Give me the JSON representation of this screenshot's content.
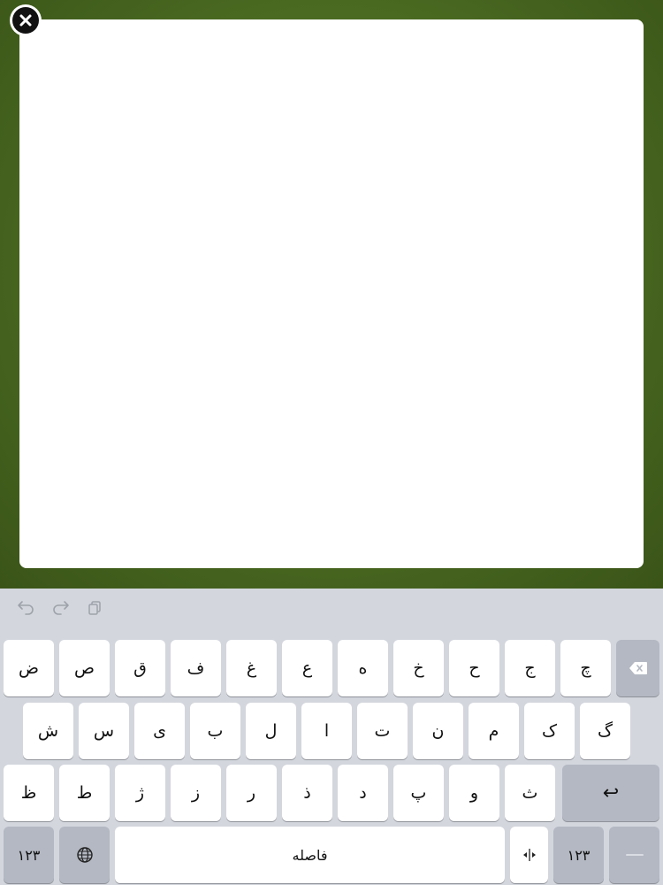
{
  "window": {
    "close_icon": "close-circle-icon"
  },
  "toolbar": {
    "icons": [
      "undo-icon",
      "redo-icon",
      "paste-icon"
    ]
  },
  "keyboard": {
    "row1": [
      "ض",
      "ص",
      "ق",
      "ف",
      "غ",
      "ع",
      "ه",
      "خ",
      "ح",
      "ج",
      "چ"
    ],
    "row2": [
      "ش",
      "س",
      "ی",
      "ب",
      "ل",
      "ا",
      "ت",
      "ن",
      "م",
      "ک",
      "گ"
    ],
    "row3": [
      "ظ",
      "ط",
      "ژ",
      "ز",
      "ر",
      "ذ",
      "د",
      "پ",
      "و",
      "ث"
    ],
    "numbers_key": "١٢٣",
    "space_label": "فاصله",
    "return_symbol": "↩",
    "colors": {
      "key": "#ffffff",
      "special_key": "#b3b8c2",
      "background": "#d3d6dd",
      "scene": "#4a6a21"
    }
  }
}
